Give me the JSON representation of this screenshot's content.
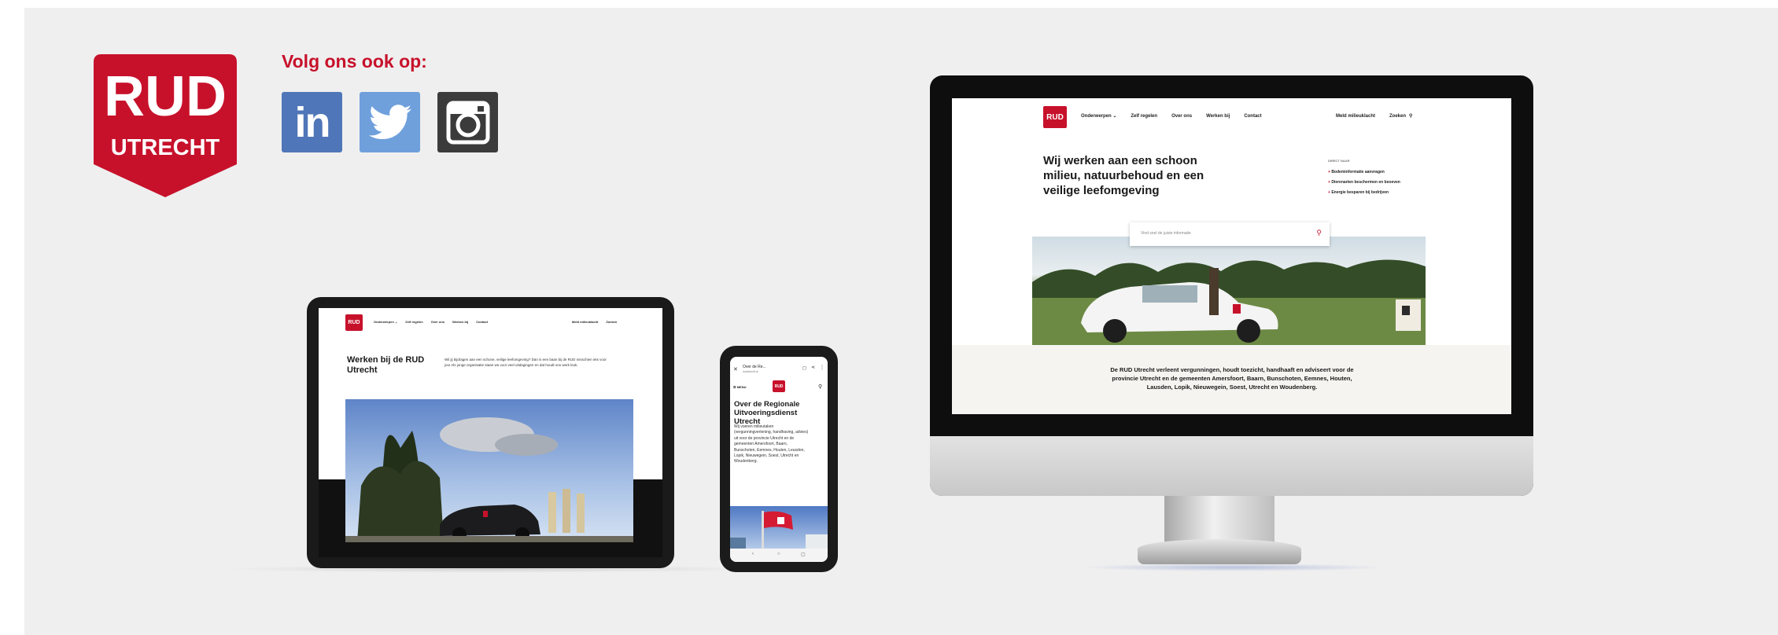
{
  "brand": {
    "line1": "RUD",
    "line2": "UTRECHT",
    "color": "#c7112b"
  },
  "social": {
    "heading": "Volg ons ook op:",
    "icons": [
      {
        "name": "linkedin-icon",
        "label": "in",
        "color": "#4f76b8"
      },
      {
        "name": "twitter-icon",
        "color": "#6fa0dc"
      },
      {
        "name": "instagram-icon",
        "color": "#3b3b3b"
      }
    ]
  },
  "desktop": {
    "logo_text": "RUD",
    "nav": [
      "Onderwerpen ⌄",
      "Zelf regelen",
      "Over ons",
      "Werken bij",
      "Contact"
    ],
    "nav_right": [
      "Meld milieuklacht",
      "Zoeken"
    ],
    "hero_title": "Wij werken aan een schoon milieu, natuurbehoud en een veilige leefomgeving",
    "direct_label": "DIRECT NAAR",
    "direct_links": [
      "Bodeminformatie aanvragen",
      "Dierenarten beschermen en beoeven",
      "Energie besparen bij bedrijven"
    ],
    "search_placeholder": "Vind snel de juiste informatie",
    "body": "De RUD Utrecht verleent vergunningen, houdt toezicht, handhaaft en adviseert voor de provincie Utrecht en de gemeenten Amersfoort, Baarn, Bunschoten, Eemnes, Houten, Lausden, Lopik, Nieuwegein, Soest, Utrecht en Woudenberg."
  },
  "tablet": {
    "logo_text": "RUD",
    "nav": [
      "Onderwerpen ⌄",
      "Zelf regelen",
      "Over ons",
      "Werken bij",
      "Contact"
    ],
    "nav_right": [
      "Meld milieuklacht",
      "Zoeken"
    ],
    "title": "Werken bij de RUD Utrecht",
    "intro": "Wil jij bijdragen aan een schone, veilige leefomgeving? Dan is een baan bij de RUD misschien iets voor jou! Als jonge organisatie staan we voor veel uitdagingen en dat houdt ons werk leuk."
  },
  "phone": {
    "url_title": "Over de Re...",
    "url_sub": "rudutrecht.nl",
    "menu": "MENU",
    "logo_text": "RUD",
    "title": "Over de Regionale Uitvoeringsdienst Utrecht",
    "body": "Wij voeren milieutaken (vergunningverlening, handhaving, advies) uit voor de provincie Utrecht en de gemeenten Amersfoort, Baarn, Bunschoten, Eemnes, Houten, Leusden, Lopik, Nieuwegein, Soest, Utrecht en Woudenberg."
  }
}
